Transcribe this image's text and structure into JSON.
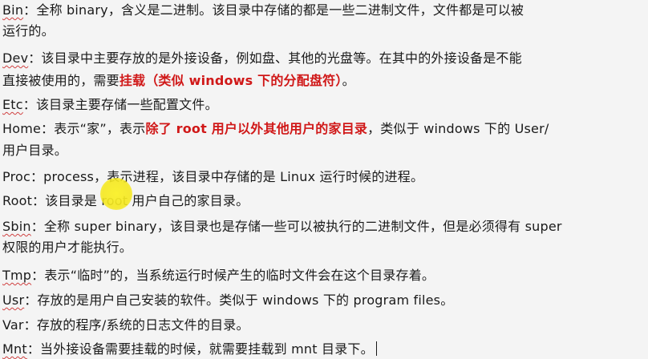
{
  "lines": [
    {
      "term": "Bin",
      "a": "：全称 binary，含义是二进制。该目录中存储的都是一些二进制文件，文件都是可以被"
    },
    {
      "a": "运行的。"
    },
    {
      "term": "Dev",
      "a": "：该目录中主要存放的是外接设备，例如盘、其他的光盘等。在其中的外接设备是不能"
    },
    {
      "a": "直接被使用的，需要",
      "red": "挂载（类似 windows 下的分配盘符）",
      "b": "。"
    },
    {
      "term": "Etc",
      "a": "：该目录主要存储一些配置文件。"
    },
    {
      "a": "Home：表示“家”，表示",
      "red": "除了 root 用户以外其他用户的家目录",
      "b": "，类似于 windows 下的 User/"
    },
    {
      "a": "用户目录。"
    },
    {
      "a": "Proc：process，表示进程，该目录中存储的是 Linux 运行时候的进程。"
    },
    {
      "a": "Root：该目录是 root 用户自己的家目录。"
    },
    {
      "term": "Sbin",
      "a": "：全称 super binary，该目录也是存储一些可以被执行的二进制文件，但是必须得有 super"
    },
    {
      "a": "权限的用户才能执行。"
    },
    {
      "term": "Tmp",
      "a": "：表示“临时”的，当系统运行时候产生的临时文件会在这个目录存着。"
    },
    {
      "term": "Usr",
      "a": "：存放的是用户自己安装的软件。类似于 windows 下的 program files。"
    },
    {
      "a": "Var：存放的程序/系统的日志文件的目录。"
    },
    {
      "term": "Mnt",
      "a": "：当外接设备需要挂载的时候，就需要挂载到 mnt 目录下。"
    }
  ]
}
